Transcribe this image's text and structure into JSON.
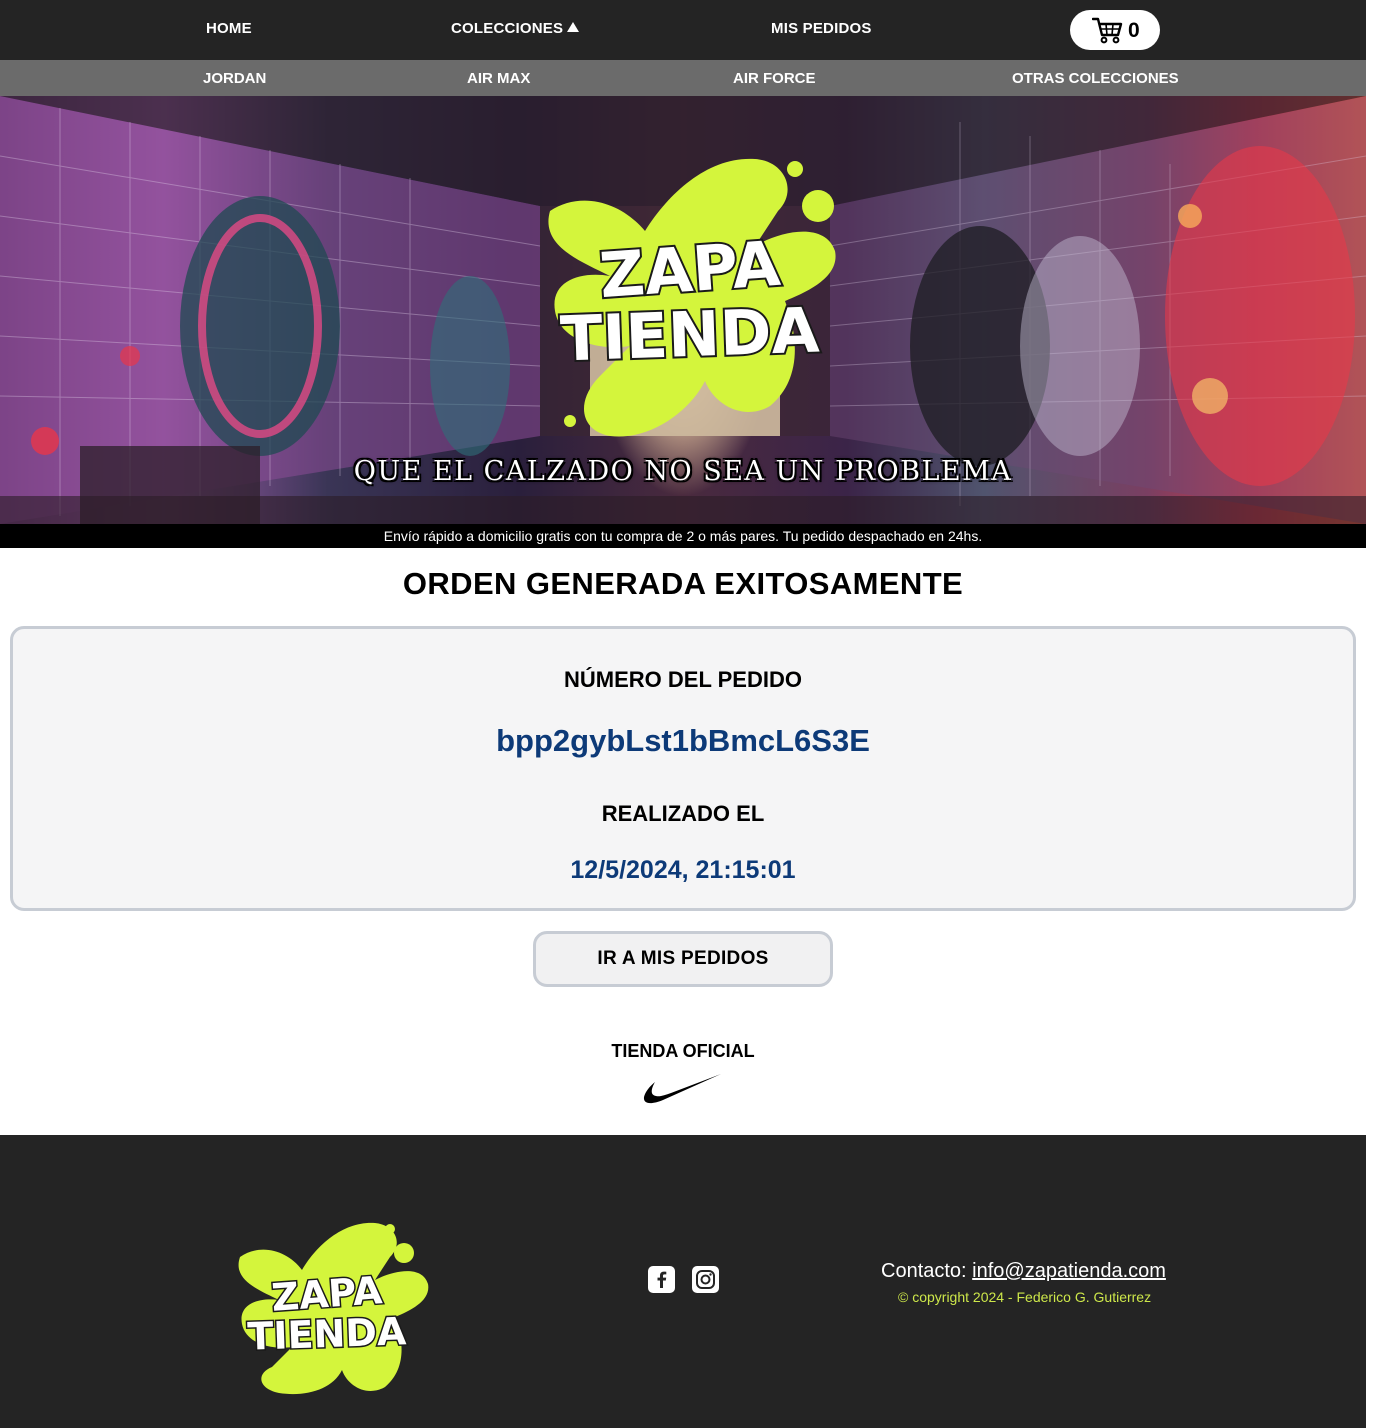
{
  "nav": {
    "home": "HOME",
    "colecciones": "COLECCIONES",
    "mis_pedidos": "MIS PEDIDOS",
    "cart_count": "0"
  },
  "subnav": {
    "jordan": "JORDAN",
    "air_max": "AIR MAX",
    "air_force": "AIR FORCE",
    "otras": "OTRAS COLECCIONES"
  },
  "hero": {
    "logo_line1": "ZAPA",
    "logo_line2": "TIENDA",
    "tagline": "QUE EL CALZADO NO SEA UN PROBLEMA"
  },
  "strip": {
    "text": "Envío rápido a domicilio gratis con tu compra de 2 o más pares. Tu pedido despachado en 24hs."
  },
  "order": {
    "title": "ORDEN GENERADA EXITOSAMENTE",
    "number_label": "NÚMERO DEL PEDIDO",
    "number_value": "bpp2gybLst1bBmcL6S3E",
    "date_label": "REALIZADO EL",
    "date_value": "12/5/2024, 21:15:01",
    "button_label": "IR A MIS PEDIDOS"
  },
  "brand": {
    "official_label": "TIENDA OFICIAL"
  },
  "footer": {
    "logo_line1": "ZAPA",
    "logo_line2": "TIENDA",
    "contact_label": "Contacto:",
    "contact_email": "info@zapatienda.com",
    "copyright": "© copyright 2024 - Federico G. Gutierrez"
  },
  "colors": {
    "nav_bg": "#242424",
    "subnav_bg": "#6b6b6b",
    "accent_lime": "#d4f53c",
    "order_value_blue": "#0d3a78",
    "copyright_lime": "#cde74a"
  },
  "icons": {
    "cart": "cart-icon",
    "caret": "caret-up-icon",
    "facebook": "facebook-icon",
    "instagram": "instagram-icon",
    "nike": "nike-swoosh-icon"
  }
}
